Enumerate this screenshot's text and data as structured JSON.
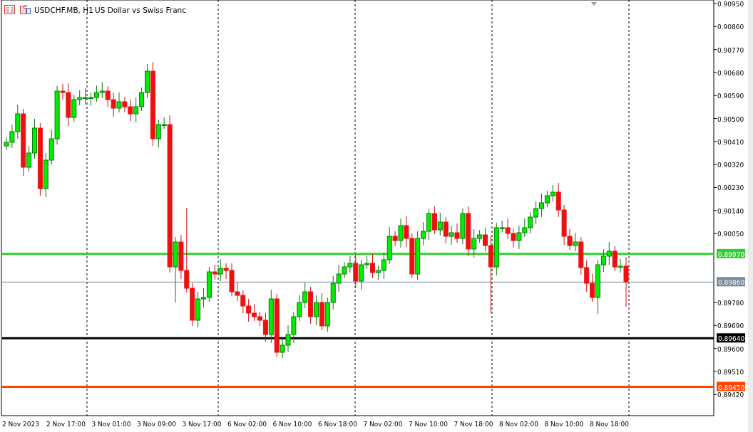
{
  "chart_title": {
    "symbol": "USDCHF.MB, H1",
    "description": "US Dollar vs Swiss Franc"
  },
  "price_axis": [
    "0.90950",
    "0.90860",
    "0.90770",
    "0.90680",
    "0.90590",
    "0.90500",
    "0.90410",
    "0.90320",
    "0.90230",
    "0.90140",
    "0.90050",
    "0.89780",
    "0.89690",
    "0.89600",
    "0.89510",
    "0.89420"
  ],
  "price_levels": [
    {
      "label": "0.89970",
      "color": "#32cd32",
      "kind": "level"
    },
    {
      "label": "0.89860",
      "color": "#778899",
      "kind": "bid"
    },
    {
      "label": "0.89640",
      "color": "#000000",
      "kind": "level"
    },
    {
      "label": "0.89450",
      "color": "#ff4500",
      "kind": "level"
    }
  ],
  "time_axis": [
    "2 Nov 2023",
    "2 Nov 17:00",
    "3 Nov 01:00",
    "3 Nov 09:00",
    "3 Nov 17:00",
    "6 Nov 02:00",
    "6 Nov 10:00",
    "6 Nov 18:00",
    "7 Nov 02:00",
    "7 Nov 10:00",
    "7 Nov 18:00",
    "8 Nov 02:00",
    "8 Nov 10:00",
    "8 Nov 18:00"
  ]
}
